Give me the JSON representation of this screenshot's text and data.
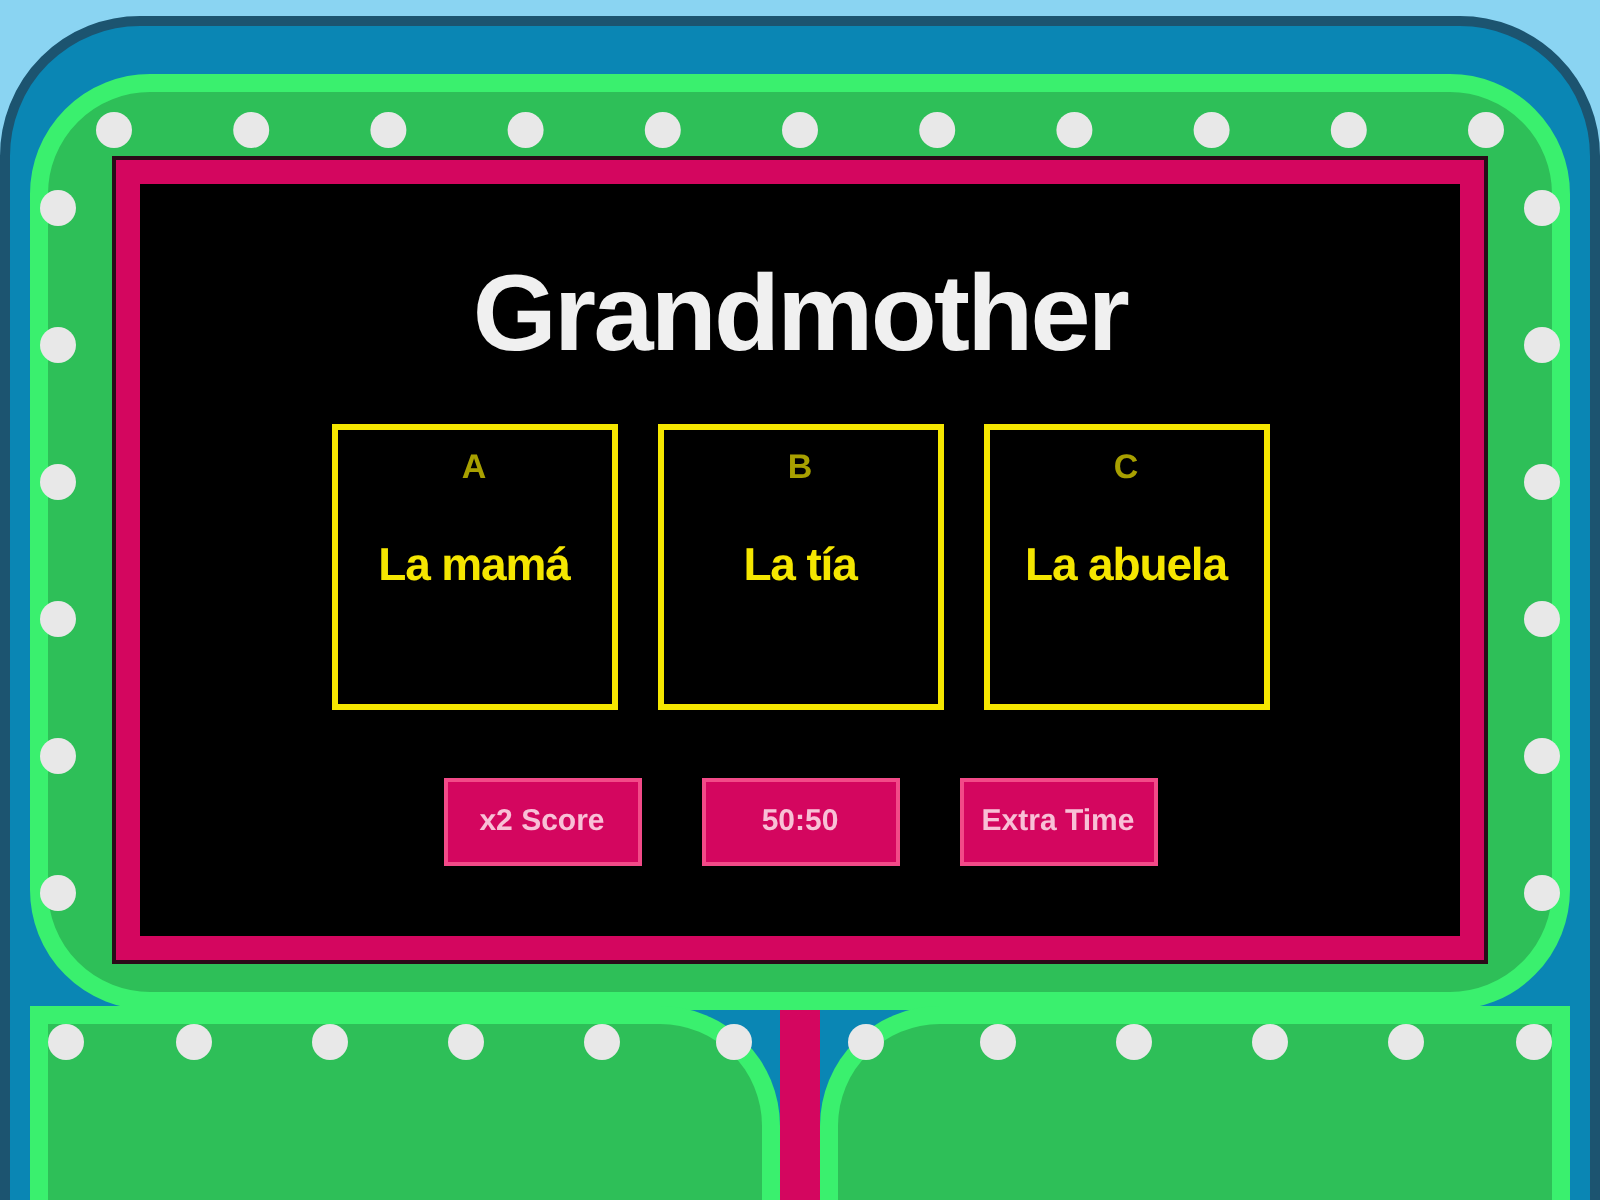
{
  "question": "Grandmother",
  "options": [
    {
      "letter": "A",
      "text": "La mamá"
    },
    {
      "letter": "B",
      "text": "La tía"
    },
    {
      "letter": "C",
      "text": "La abuela"
    }
  ],
  "powerups": [
    "x2 Score",
    "50:50",
    "Extra Time"
  ]
}
